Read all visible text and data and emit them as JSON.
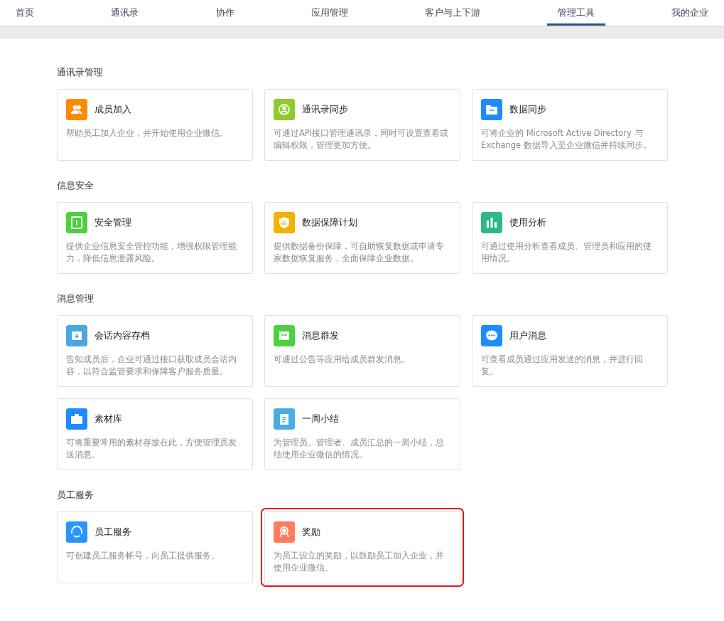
{
  "nav": {
    "tabs": [
      {
        "label": "首页",
        "selected": false
      },
      {
        "label": "通讯录",
        "selected": false
      },
      {
        "label": "协作",
        "selected": false
      },
      {
        "label": "应用管理",
        "selected": false
      },
      {
        "label": "客户与上下游",
        "selected": false
      },
      {
        "label": "管理工具",
        "selected": true
      },
      {
        "label": "我的企业",
        "selected": false
      }
    ]
  },
  "sections": [
    {
      "title": "通讯录管理",
      "items": [
        {
          "name": "成员加入",
          "description": "帮助员工加入企业，并开始使用企业微信。",
          "kind": "people",
          "color": "#ff8a00",
          "highlighted": false
        },
        {
          "name": "通讯录同步",
          "description": "可通过API接口管理通讯录，同时可设置查看或编辑权限，管理更加方便。",
          "kind": "sync",
          "color": "#8ccb2a",
          "highlighted": false
        },
        {
          "name": "数据同步",
          "description": "可将企业的 Microsoft Active Directory 与 Exchange 数据导入至企业微信并持续同步。",
          "kind": "folder",
          "color": "#1e8cff",
          "highlighted": false
        }
      ]
    },
    {
      "title": "信息安全",
      "items": [
        {
          "name": "安全管理",
          "description": "提供企业信息安全管控功能，增强权限管理能力，降低信息泄露风险。",
          "kind": "safe",
          "color": "#4cd13e",
          "highlighted": false
        },
        {
          "name": "数据保障计划",
          "description": "提供数据备份保障，可自助恢复数据或申请专家数据恢复服务，全面保障企业数据。",
          "kind": "shield",
          "color": "#f2b300",
          "highlighted": false
        },
        {
          "name": "使用分析",
          "description": "可通过使用分析查看成员、管理员和应用的使用情况。",
          "kind": "bars",
          "color": "#2fb98b",
          "highlighted": false
        }
      ]
    },
    {
      "title": "消息管理",
      "items": [
        {
          "name": "会话内容存档",
          "description": "告知成员后，企业可通过接口获取成员会话内容，以符合监管要求和保障客户服务质量。",
          "kind": "archive",
          "color": "#4aa8e0",
          "highlighted": false
        },
        {
          "name": "消息群发",
          "description": "可通过公告等应用给成员群发消息。",
          "kind": "group",
          "color": "#4cd13e",
          "highlighted": false
        },
        {
          "name": "用户消息",
          "description": "可查看成员通过应用发送的消息，并进行回复。",
          "kind": "chat",
          "color": "#1e8cff",
          "highlighted": false
        },
        {
          "name": "素材库",
          "description": "可将重要常用的素材存放在此，方便管理员发送消息。",
          "kind": "briefcase",
          "color": "#1e8cff",
          "highlighted": false
        },
        {
          "name": "一周小结",
          "description": "为管理员、管理者、成员汇总的一周小结，总结使用企业微信的情况。",
          "kind": "clipboard",
          "color": "#4aace6",
          "highlighted": false
        }
      ]
    },
    {
      "title": "员工服务",
      "items": [
        {
          "name": "员工服务",
          "description": "可创建员工服务帐号，向员工提供服务。",
          "kind": "headset",
          "color": "#2896ff",
          "highlighted": false
        },
        {
          "name": "奖励",
          "description": "为员工设立的奖励，以鼓励员工加入企业，并使用企业微信。",
          "kind": "medal",
          "color": "#ff7c5c",
          "highlighted": true
        }
      ]
    }
  ]
}
